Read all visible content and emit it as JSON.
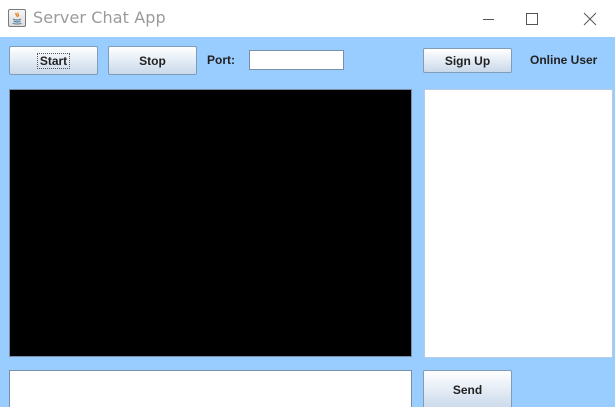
{
  "window": {
    "title": "Server Chat App",
    "icon": "java-icon",
    "controls": [
      "minimize-icon",
      "maximize-icon",
      "close-icon"
    ]
  },
  "toolbar": {
    "start_label": "Start",
    "stop_label": "Stop",
    "port_label": "Port:",
    "port_value": "",
    "signup_label": "Sign Up",
    "online_user_label": "Online User"
  },
  "footer": {
    "send_label": "Send",
    "message_value": ""
  },
  "colors": {
    "panel_background": "#99ccff",
    "chat_background": "#000000",
    "list_background": "#ffffff"
  }
}
